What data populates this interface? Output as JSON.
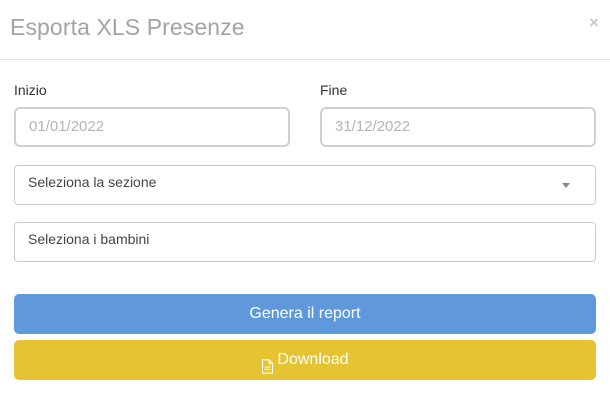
{
  "modal": {
    "title": "Esporta XLS Presenze",
    "close_glyph": "×"
  },
  "form": {
    "start": {
      "label": "Inizio",
      "value": "01/01/2022"
    },
    "end": {
      "label": "Fine",
      "value": "31/12/2022"
    },
    "section_select": {
      "placeholder": "Seleziona la sezione",
      "icon": "chevron-down-icon"
    },
    "children_select": {
      "placeholder": "Seleziona i bambini"
    }
  },
  "actions": {
    "generate_label": "Genera il report",
    "download_label": "Download",
    "download_icon": "document-icon"
  },
  "colors": {
    "generate_button": "#5f99dc",
    "download_button": "#e6c332",
    "title_text": "#a3a3a3"
  }
}
